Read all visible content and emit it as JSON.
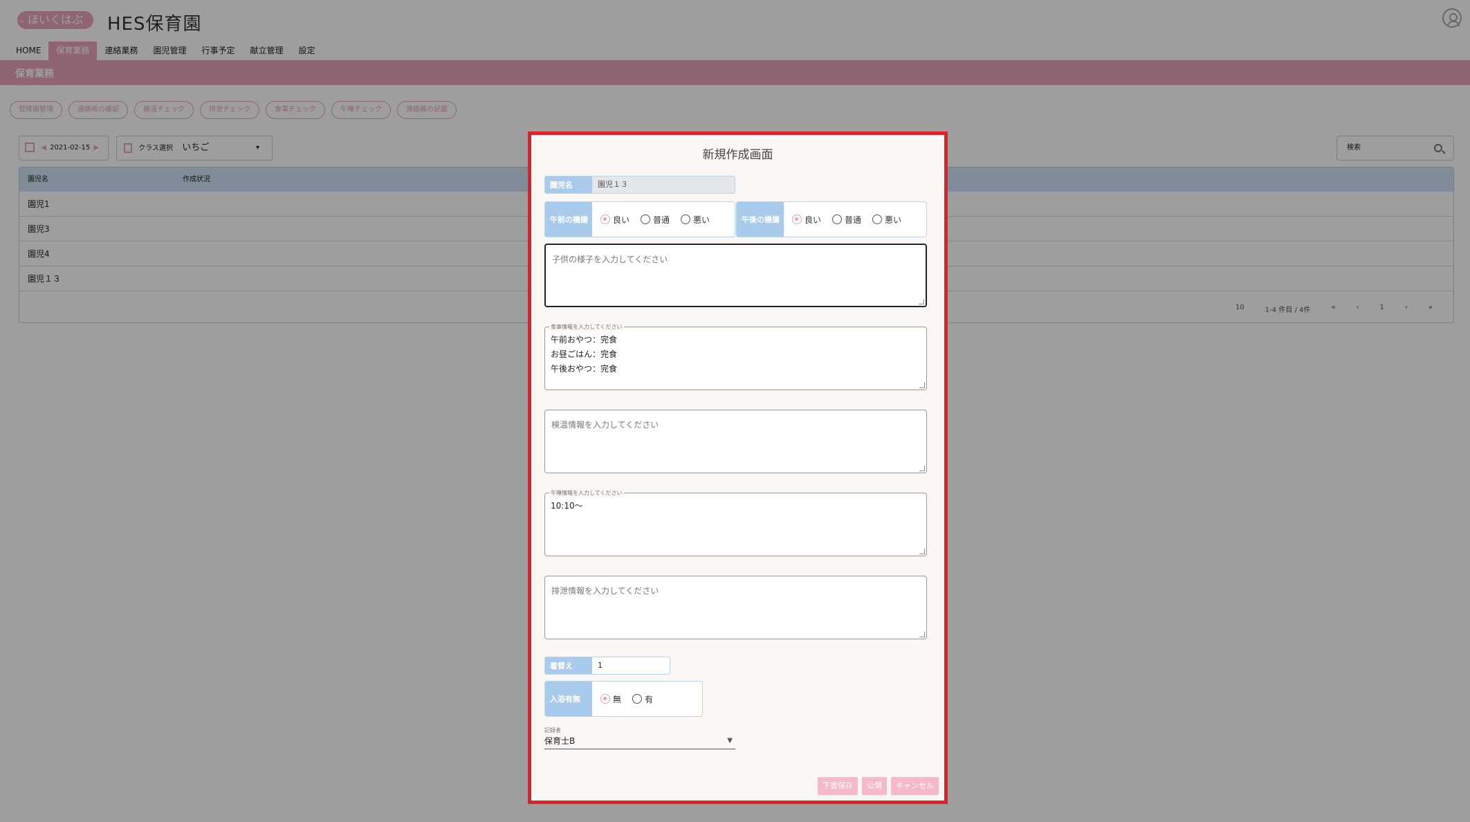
{
  "app": {
    "logo": "ほいくはぶ",
    "title": "HES保育園"
  },
  "nav": {
    "items": [
      "HOME",
      "保育業務",
      "連絡業務",
      "園児管理",
      "行事予定",
      "献立管理",
      "設定"
    ],
    "active_index": 1
  },
  "section_title": "保育業務",
  "actions": [
    "登降園管理",
    "連絡帳の確認",
    "検温チェック",
    "排泄チェック",
    "食事チェック",
    "午睡チェック",
    "連絡帳の記載"
  ],
  "filters": {
    "date": "2021-02-15",
    "class_label": "クラス選択",
    "class_value": "いちご",
    "search_placeholder": "検索"
  },
  "table": {
    "headers": [
      "園児名",
      "作成状況"
    ],
    "rows": [
      "園児1",
      "園児3",
      "園児4",
      "園児１３"
    ],
    "pager": {
      "per_page": "10",
      "range": "1-4 件目 / 4件",
      "page": "1"
    }
  },
  "modal": {
    "title": "新規作成画面",
    "name_label": "園児名",
    "name_value": "園児１３",
    "am_mood": {
      "label": "午前の機嫌",
      "options": [
        "良い",
        "普通",
        "悪い"
      ],
      "selected": 0
    },
    "pm_mood": {
      "label": "午後の機嫌",
      "options": [
        "良い",
        "普通",
        "悪い"
      ],
      "selected": 0
    },
    "child_note_placeholder": "子供の様子を入力してください",
    "meal": {
      "legend": "食事情報を入力してください",
      "lines": [
        "午前おやつ：完食",
        "お昼ごはん：完食",
        "午後おやつ：完食"
      ]
    },
    "temp_placeholder": "検温情報を入力してください",
    "nap": {
      "legend": "午睡情報を入力してください",
      "value": "10:10〜"
    },
    "excretion_placeholder": "排泄情報を入力してください",
    "change_label": "着替え",
    "change_value": "1",
    "bath": {
      "label": "入浴有無",
      "options": [
        "無",
        "有"
      ],
      "selected": 0
    },
    "recorder_label": "記録者",
    "recorder_value": "保育士B",
    "buttons": {
      "draft": "下書保存",
      "publish": "公開",
      "cancel": "キャンセル"
    }
  },
  "colors": {
    "accent_pink": "#e7a3b9",
    "label_blue": "#a8cbeb",
    "highlight_red": "#e01f26"
  }
}
